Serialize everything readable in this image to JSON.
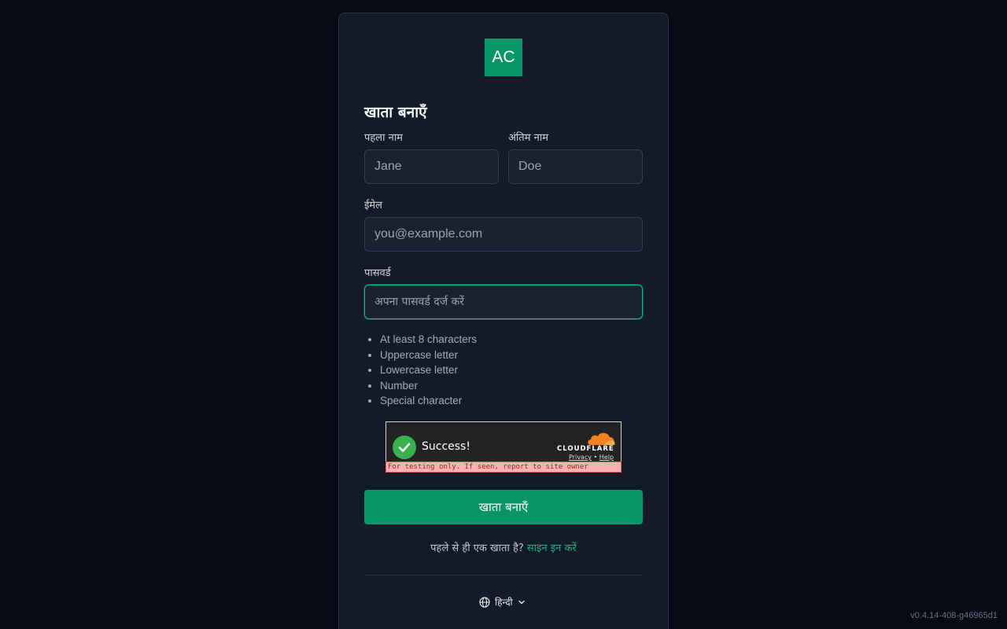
{
  "logo": {
    "text": "AC",
    "color": "#089669"
  },
  "form": {
    "title": "खाता बनाएँ",
    "first_name": {
      "label": "पहला नाम",
      "placeholder": "Jane",
      "value": ""
    },
    "last_name": {
      "label": "अंतिम नाम",
      "placeholder": "Doe",
      "value": ""
    },
    "email": {
      "label": "ईमेल",
      "placeholder": "you@example.com",
      "value": ""
    },
    "password": {
      "label": "पासवर्ड",
      "placeholder": "अपना पासवर्ड दर्ज करें",
      "value": ""
    },
    "password_rules": [
      "At least 8 characters",
      "Uppercase letter",
      "Lowercase letter",
      "Number",
      "Special character"
    ],
    "submit_label": "खाता बनाएँ"
  },
  "captcha": {
    "status": "Success!",
    "brand": "CLOUDFLARE",
    "privacy_link": "Privacy",
    "separator": "•",
    "help_link": "Help",
    "test_notice": "For testing only. If seen, report to site owner",
    "icon": "check-circle-icon"
  },
  "signin": {
    "prompt": "पहले से ही एक खाता है?",
    "link": "साइन इन करें"
  },
  "language": {
    "selected": "हिन्दी",
    "icon": "globe-icon"
  },
  "version": "v0.4.14-408-g46965d1",
  "colors": {
    "accent": "#089669",
    "link": "#10b981",
    "background": "#050a14",
    "card": "#141a28"
  }
}
